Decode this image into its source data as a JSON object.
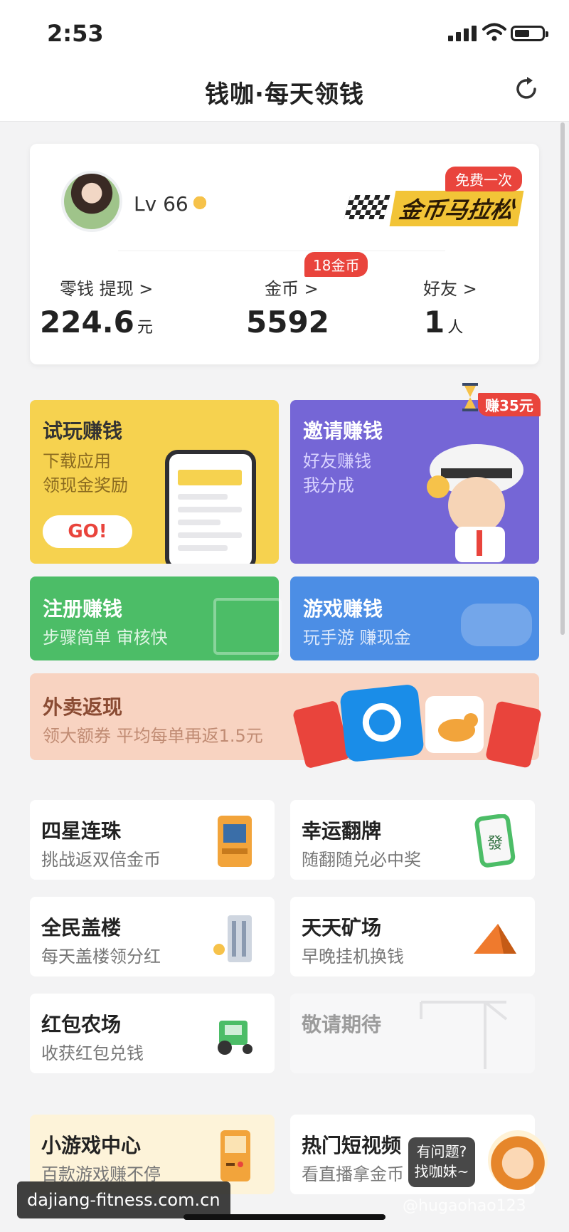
{
  "status": {
    "time": "2:53"
  },
  "nav": {
    "title": "钱咖·每天领钱"
  },
  "profile": {
    "level": "Lv 66",
    "free_badge": "免费一次",
    "marathon": "金币马拉松",
    "coin_badge": "18金币",
    "stats": [
      {
        "label": "零钱  提现 >",
        "value": "224.6",
        "unit": "元"
      },
      {
        "label": "金币 >",
        "value": "5592",
        "unit": ""
      },
      {
        "label": "好友 >",
        "value": "1",
        "unit": "人"
      }
    ]
  },
  "tiles": {
    "try": {
      "title": "试玩赚钱",
      "line1": "下载应用",
      "line2": "领现金奖励",
      "go": "GO!"
    },
    "invite": {
      "title": "邀请赚钱",
      "line1": "好友赚钱",
      "line2": "我分成",
      "badge": "赚35元"
    },
    "register": {
      "title": "注册赚钱",
      "line1": "步骤简单  审核快"
    },
    "games": {
      "title": "游戏赚钱",
      "line1": "玩手游  赚现金"
    },
    "delivery": {
      "title": "外卖返现",
      "line1": "领大额券  平均每单再返1.5元"
    }
  },
  "game_items": [
    {
      "title": "四星连珠",
      "sub": "挑战返双倍金币",
      "icon": "arcade-icon"
    },
    {
      "title": "幸运翻牌",
      "sub": "随翻随兑必中奖",
      "icon": "mahjong-tile-icon"
    },
    {
      "title": "全民盖楼",
      "sub": "每天盖楼领分红",
      "icon": "building-crane-icon"
    },
    {
      "title": "天天矿场",
      "sub": "早晚挂机换钱",
      "icon": "mine-tent-icon"
    },
    {
      "title": "红包农场",
      "sub": "收获红包兑钱",
      "icon": "tractor-icon"
    },
    {
      "title": "敬请期待",
      "sub": "",
      "icon": "construction-crane-icon"
    },
    {
      "title": "小游戏中心",
      "sub": "百款游戏赚不停",
      "icon": "gameboy-icon"
    },
    {
      "title": "热门短视频",
      "sub": "看直播拿金币",
      "icon": "video-clapper-icon"
    }
  ],
  "help": {
    "line1": "有问题?",
    "line2": "找咖妹~"
  },
  "watermark": "dajiang-fitness.com.cn",
  "corner": "@hugaohao123",
  "colors": {
    "yellow": "#f6d24f",
    "purple": "#7566d6",
    "green": "#4cbd67",
    "blue": "#4c8ee5",
    "peach": "#f8d3c1",
    "red": "#e9443c"
  }
}
